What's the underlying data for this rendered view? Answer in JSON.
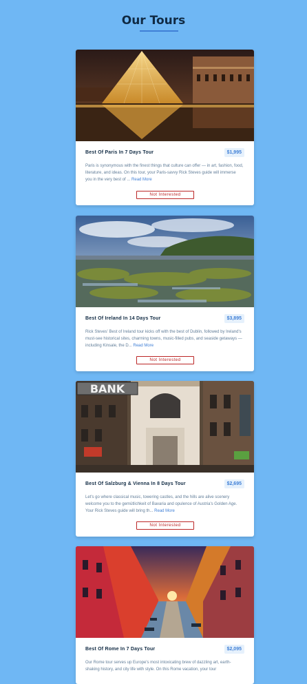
{
  "page": {
    "title": "Our Tours"
  },
  "tours": [
    {
      "name": "Best Of Paris In 7 Days Tour",
      "price": "$1,995",
      "description": "Paris is synonymous with the finest things that culture can offer — in art, fashion, food, literature, and ideas. On this tour, your Paris-savvy Rick Steves guide will immerse you in the very best of ...",
      "read_more": "Read More",
      "button": "Not Interested"
    },
    {
      "name": "Best Of Ireland In 14 Days Tour",
      "price": "$3,895",
      "description": "Rick Steves' Best of Ireland tour kicks off with the best of Dublin, followed by Ireland's must-see historical sites, charming towns, music-filled pubs, and seaside getaways — including Kinsale, the D...",
      "read_more": "Read More",
      "button": "Not Interested"
    },
    {
      "name": "Best Of Salzburg & Vienna In 8 Days Tour",
      "price": "$2,695",
      "description": "Let's go where classical music, towering castles, and the hills are alive scenery welcome you to the gemütlichkeit of Bavaria and opulence of Austria's Golden Age. Your Rick Steves guide will bring th...",
      "read_more": "Read More",
      "button": "Not Interested",
      "sign_bank": "BANK"
    },
    {
      "name": "Best Of Rome In 7 Days Tour",
      "price": "$2,095",
      "description": "Our Rome tour serves up Europe's most intoxicating brew of dazzling art, earth-shaking history, and city life with style. On this Rome vacation, your tour"
    }
  ]
}
